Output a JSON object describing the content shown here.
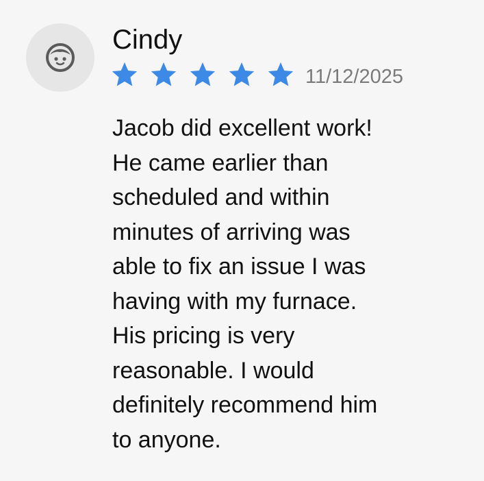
{
  "review": {
    "reviewer_name": "Cindy",
    "avatar_icon": "user-face-icon",
    "rating": 5,
    "rating_max": 5,
    "star_color": "#3d8ae6",
    "date": "11/12/2025",
    "body_lines": [
      "Jacob did excellent work!",
      "He came earlier than",
      "scheduled and within",
      "minutes of arriving was",
      "able to fix an issue I was",
      "having with my furnace.",
      "His pricing is very",
      "reasonable. I would",
      "definitely recommend him",
      "to anyone."
    ]
  }
}
